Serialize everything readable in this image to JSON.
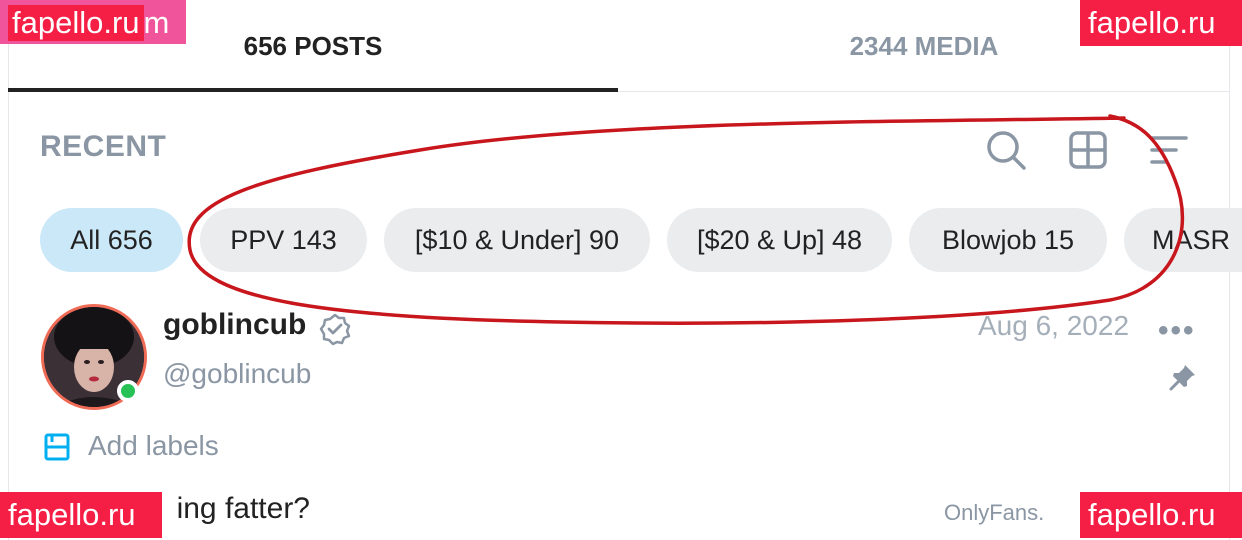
{
  "tabs": [
    {
      "label": "656 POSTS",
      "active": true
    },
    {
      "label": "2344 MEDIA",
      "active": false
    }
  ],
  "section": {
    "title": "RECENT",
    "icons": [
      "search-icon",
      "grid-icon",
      "sort-icon"
    ]
  },
  "filters": [
    {
      "label": "All 656",
      "active": true
    },
    {
      "label": "PPV 143",
      "active": false
    },
    {
      "label": "[$10 & Under] 90",
      "active": false
    },
    {
      "label": "[$20 & Up] 48",
      "active": false
    },
    {
      "label": "Blowjob 15",
      "active": false
    },
    {
      "label": "MASR",
      "active": false
    }
  ],
  "post": {
    "author_name": "goblincub",
    "author_handle": "@goblincub",
    "date": "Aug 6, 2022",
    "more": "•••",
    "add_labels": "Add labels",
    "text": "ing fatter?",
    "credit": "OnlyFans.",
    "online": true,
    "pinned": true
  },
  "watermarks": {
    "top_left": "fapello.ru",
    "top_left_trailing": "m",
    "top_right": "fapello.ru",
    "bottom_left": "fapello.ru",
    "bottom_right": "fapello.ru"
  },
  "colors": {
    "accent_blue": "#00aff0",
    "chip_active": "#cbe8f8",
    "chip_default": "#eaecee",
    "muted_text": "#8a96a3",
    "watermark": "#f51f46",
    "online_dot": "#28c155",
    "annotation_ink": "#c8161d"
  }
}
